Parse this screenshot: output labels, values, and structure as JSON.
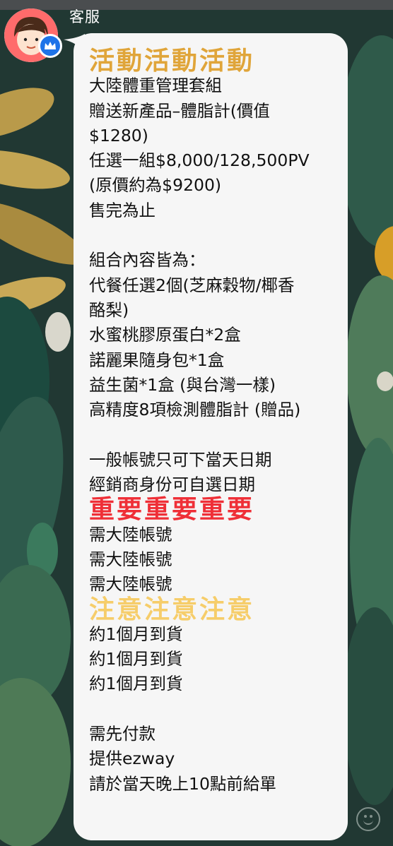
{
  "chat": {
    "sender_name": "客服",
    "message_lines": [
      {
        "text": "活動活動活動",
        "style": "gold"
      },
      {
        "text": "大陸體重管理套組",
        "style": "normal"
      },
      {
        "text": "贈送新產品–體脂計(價值",
        "style": "normal"
      },
      {
        "text": "$1280)",
        "style": "normal"
      },
      {
        "text": "任選一組$8,000/128,500PV",
        "style": "normal"
      },
      {
        "text": "(原價約為$9200)",
        "style": "normal"
      },
      {
        "text": "售完為止",
        "style": "normal"
      },
      {
        "text": "",
        "style": "blank"
      },
      {
        "text": "組合內容皆為：",
        "style": "normal"
      },
      {
        "text": "代餐任選2個(芝麻穀物/椰香",
        "style": "normal"
      },
      {
        "text": "酪梨)",
        "style": "normal"
      },
      {
        "text": "水蜜桃膠原蛋白*2盒",
        "style": "normal"
      },
      {
        "text": "諾麗果隨身包*1盒",
        "style": "normal"
      },
      {
        "text": "益生菌*1盒 (與台灣一樣)",
        "style": "normal"
      },
      {
        "text": "高精度8項檢測體脂計 (贈品)",
        "style": "normal"
      },
      {
        "text": "",
        "style": "blank"
      },
      {
        "text": "一般帳號只可下當天日期",
        "style": "normal"
      },
      {
        "text": "經銷商身份可自選日期",
        "style": "normal"
      },
      {
        "text": "重要重要重要",
        "style": "red"
      },
      {
        "text": "需大陸帳號",
        "style": "normal"
      },
      {
        "text": "需大陸帳號",
        "style": "normal"
      },
      {
        "text": "需大陸帳號",
        "style": "normal"
      },
      {
        "text": "注意注意注意",
        "style": "yellow"
      },
      {
        "text": "約1個月到貨",
        "style": "normal"
      },
      {
        "text": "約1個月到貨",
        "style": "normal"
      },
      {
        "text": "約1個月到貨",
        "style": "normal"
      },
      {
        "text": "",
        "style": "blank"
      },
      {
        "text": "需先付款",
        "style": "normal"
      },
      {
        "text": "提供ezway",
        "style": "normal"
      },
      {
        "text": "請於當天晚上10點前給單",
        "style": "normal"
      }
    ]
  },
  "icons": {
    "avatar": "avatar-cartoon-person",
    "badge": "crown-icon",
    "emoji": "smiley-icon"
  },
  "colors": {
    "bubble": "#f6f6f6",
    "gold_text": "#e0a53a",
    "red_text": "#ef2f37",
    "yellow_text": "#f6cd6a",
    "badge_blue": "#1e73e8"
  }
}
